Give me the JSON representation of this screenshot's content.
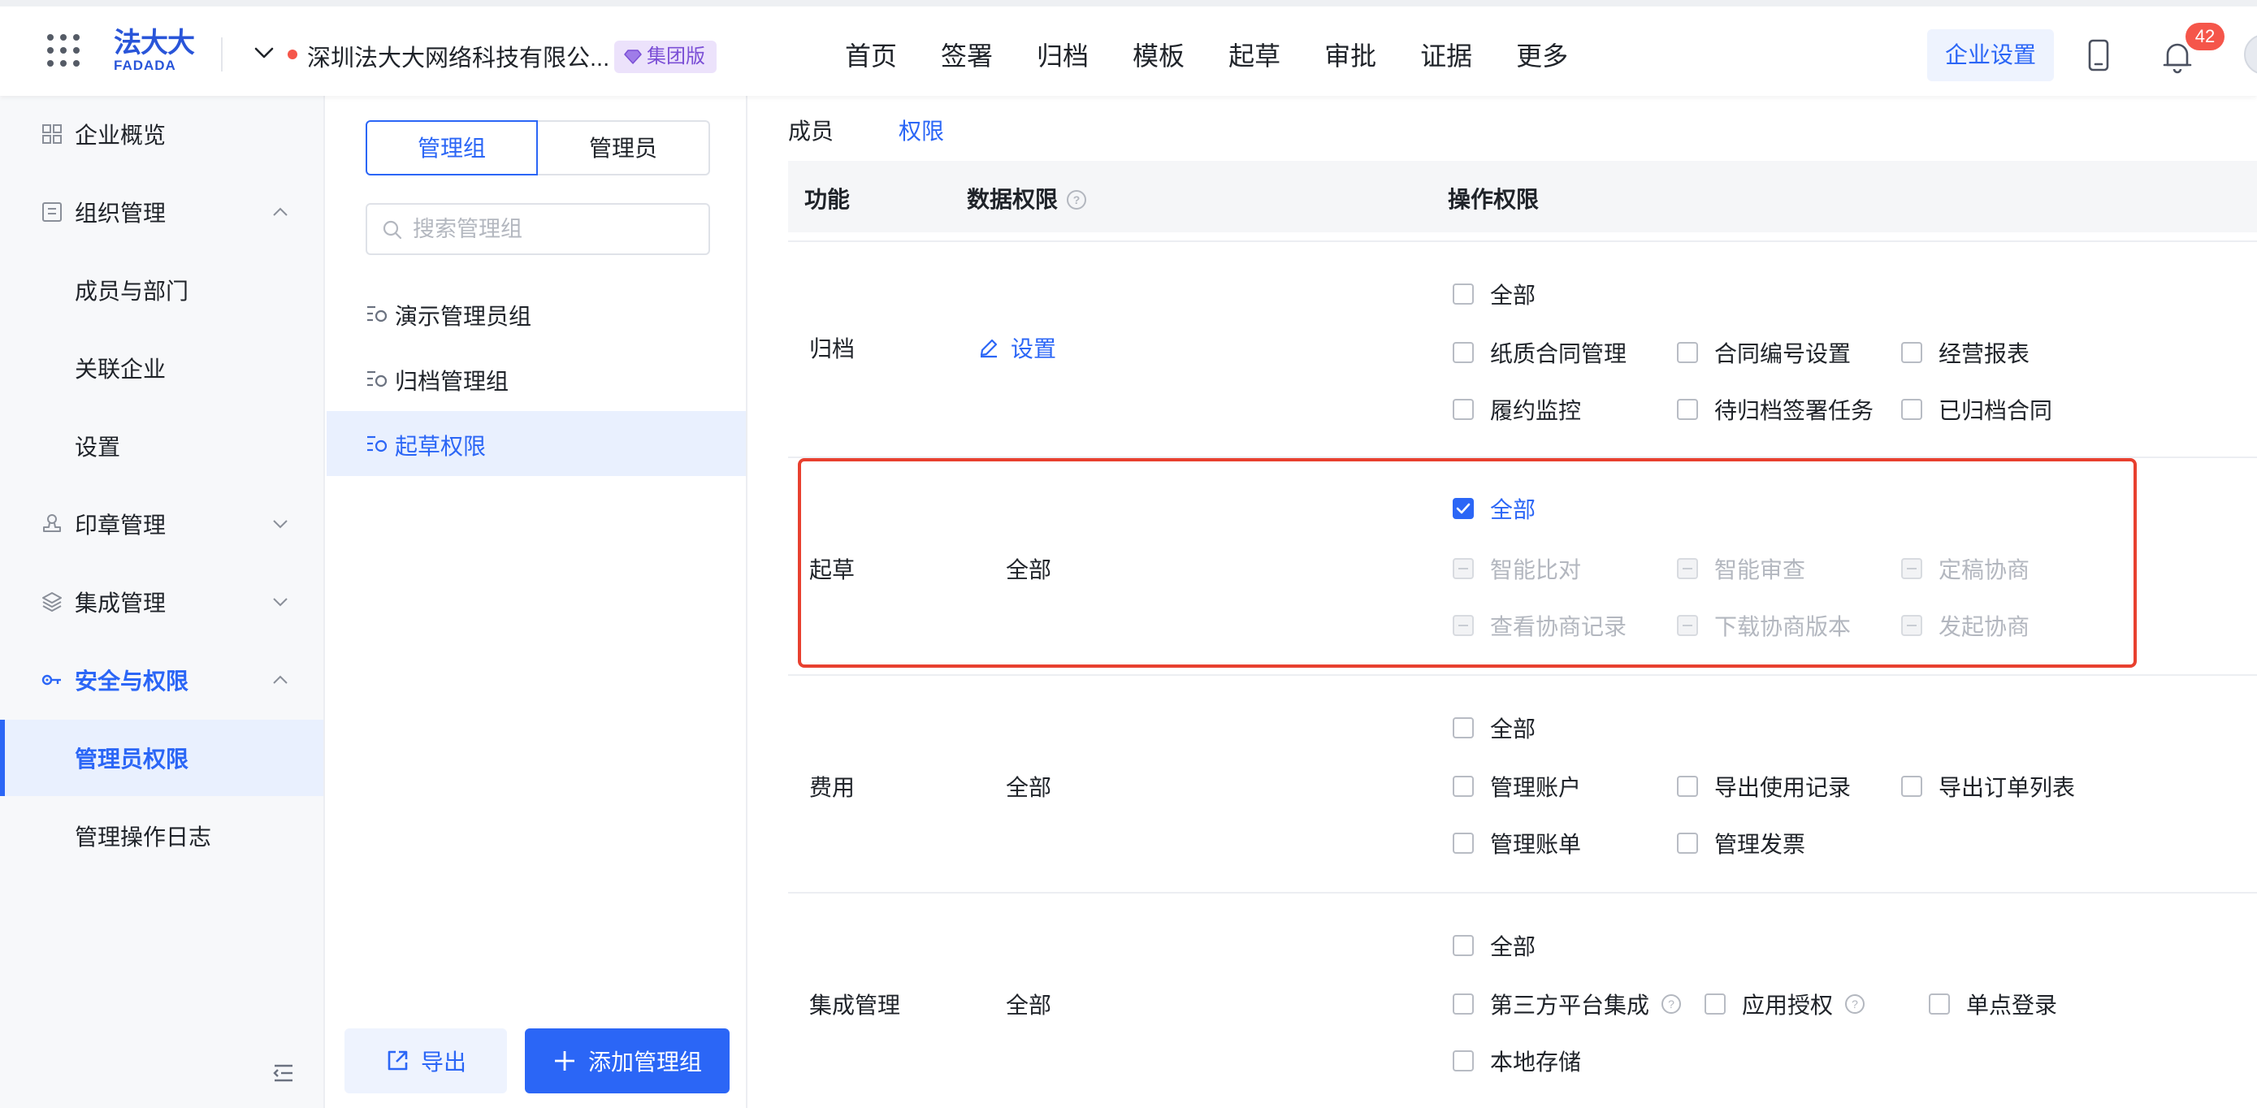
{
  "header": {
    "logo_cn": "法大大",
    "logo_en": "FADADA",
    "company_name": "深圳法大大网络科技有限公...",
    "edition_badge": "集团版",
    "nav": [
      "首页",
      "签署",
      "归档",
      "模板",
      "起草",
      "审批",
      "证据",
      "更多"
    ],
    "enterprise_settings": "企业设置",
    "notification_count": "42"
  },
  "sidebar": {
    "items": [
      {
        "label": "企业概览",
        "icon": "dashboard-icon"
      },
      {
        "label": "组织管理",
        "icon": "org-icon",
        "expanded": true
      },
      {
        "label": "成员与部门"
      },
      {
        "label": "关联企业"
      },
      {
        "label": "设置"
      },
      {
        "label": "印章管理",
        "icon": "seal-icon",
        "expanded": false
      },
      {
        "label": "集成管理",
        "icon": "layers-icon",
        "expanded": false
      },
      {
        "label": "安全与权限",
        "icon": "key-icon",
        "expanded": true
      },
      {
        "label": "管理员权限"
      },
      {
        "label": "管理操作日志"
      }
    ]
  },
  "middle": {
    "segment": {
      "left": "管理组",
      "right": "管理员",
      "selected": "管理组"
    },
    "search_placeholder": "搜索管理组",
    "groups": [
      "演示管理员组",
      "归档管理组",
      "起草权限"
    ],
    "selected_group": "起草权限",
    "export_label": "导出",
    "add_label": "添加管理组"
  },
  "main": {
    "tabs": [
      "成员",
      "权限"
    ],
    "active_tab": "权限",
    "columns": {
      "function": "功能",
      "data_perm": "数据权限",
      "op_perm": "操作权限"
    },
    "rows": [
      {
        "function": "归档",
        "data_perm_link": "设置",
        "all": {
          "label": "全部",
          "state": "unchecked"
        },
        "options": [
          {
            "label": "纸质合同管理",
            "state": "unchecked"
          },
          {
            "label": "合同编号设置",
            "state": "unchecked"
          },
          {
            "label": "经营报表",
            "state": "unchecked"
          },
          {
            "label": "履约监控",
            "state": "unchecked"
          },
          {
            "label": "待归档签署任务",
            "state": "unchecked"
          },
          {
            "label": "已归档合同",
            "state": "unchecked"
          }
        ]
      },
      {
        "function": "起草",
        "data_perm": "全部",
        "all": {
          "label": "全部",
          "state": "checked"
        },
        "options": [
          {
            "label": "智能比对",
            "state": "disabled"
          },
          {
            "label": "智能审查",
            "state": "disabled"
          },
          {
            "label": "定稿协商",
            "state": "disabled"
          },
          {
            "label": "查看协商记录",
            "state": "disabled"
          },
          {
            "label": "下载协商版本",
            "state": "disabled"
          },
          {
            "label": "发起协商",
            "state": "disabled"
          }
        ]
      },
      {
        "function": "费用",
        "data_perm": "全部",
        "all": {
          "label": "全部",
          "state": "unchecked"
        },
        "options": [
          {
            "label": "管理账户",
            "state": "unchecked"
          },
          {
            "label": "导出使用记录",
            "state": "unchecked"
          },
          {
            "label": "导出订单列表",
            "state": "unchecked"
          },
          {
            "label": "管理账单",
            "state": "unchecked"
          },
          {
            "label": "管理发票",
            "state": "unchecked"
          }
        ]
      },
      {
        "function": "集成管理",
        "data_perm": "全部",
        "all": {
          "label": "全部",
          "state": "unchecked"
        },
        "options": [
          {
            "label": "第三方平台集成",
            "state": "unchecked",
            "help": true
          },
          {
            "label": "应用授权",
            "state": "unchecked",
            "help": true
          },
          {
            "label": "单点登录",
            "state": "unchecked"
          },
          {
            "label": "本地存储",
            "state": "unchecked"
          }
        ]
      }
    ]
  },
  "colors": {
    "accent": "#2b66f6",
    "highlight": "#e8402f",
    "badge": "#f5564a",
    "edition": "#7b4fd6"
  }
}
